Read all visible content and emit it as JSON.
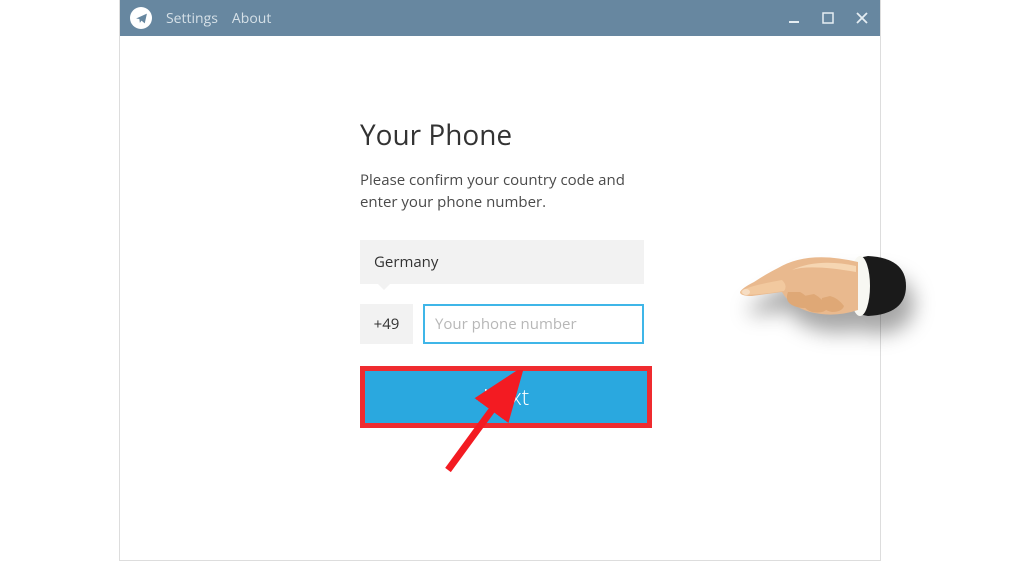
{
  "titlebar": {
    "menu": {
      "settings": "Settings",
      "about": "About"
    }
  },
  "page": {
    "heading": "Your Phone",
    "subtitle": "Please confirm your country code and enter your phone number."
  },
  "form": {
    "country": "Germany",
    "country_code": "+49",
    "phone_placeholder": "Your phone number",
    "phone_value": "",
    "next_label": "Next"
  },
  "annotations": {
    "highlight_color": "#ef2b2f",
    "arrow_color": "#f31b22"
  }
}
